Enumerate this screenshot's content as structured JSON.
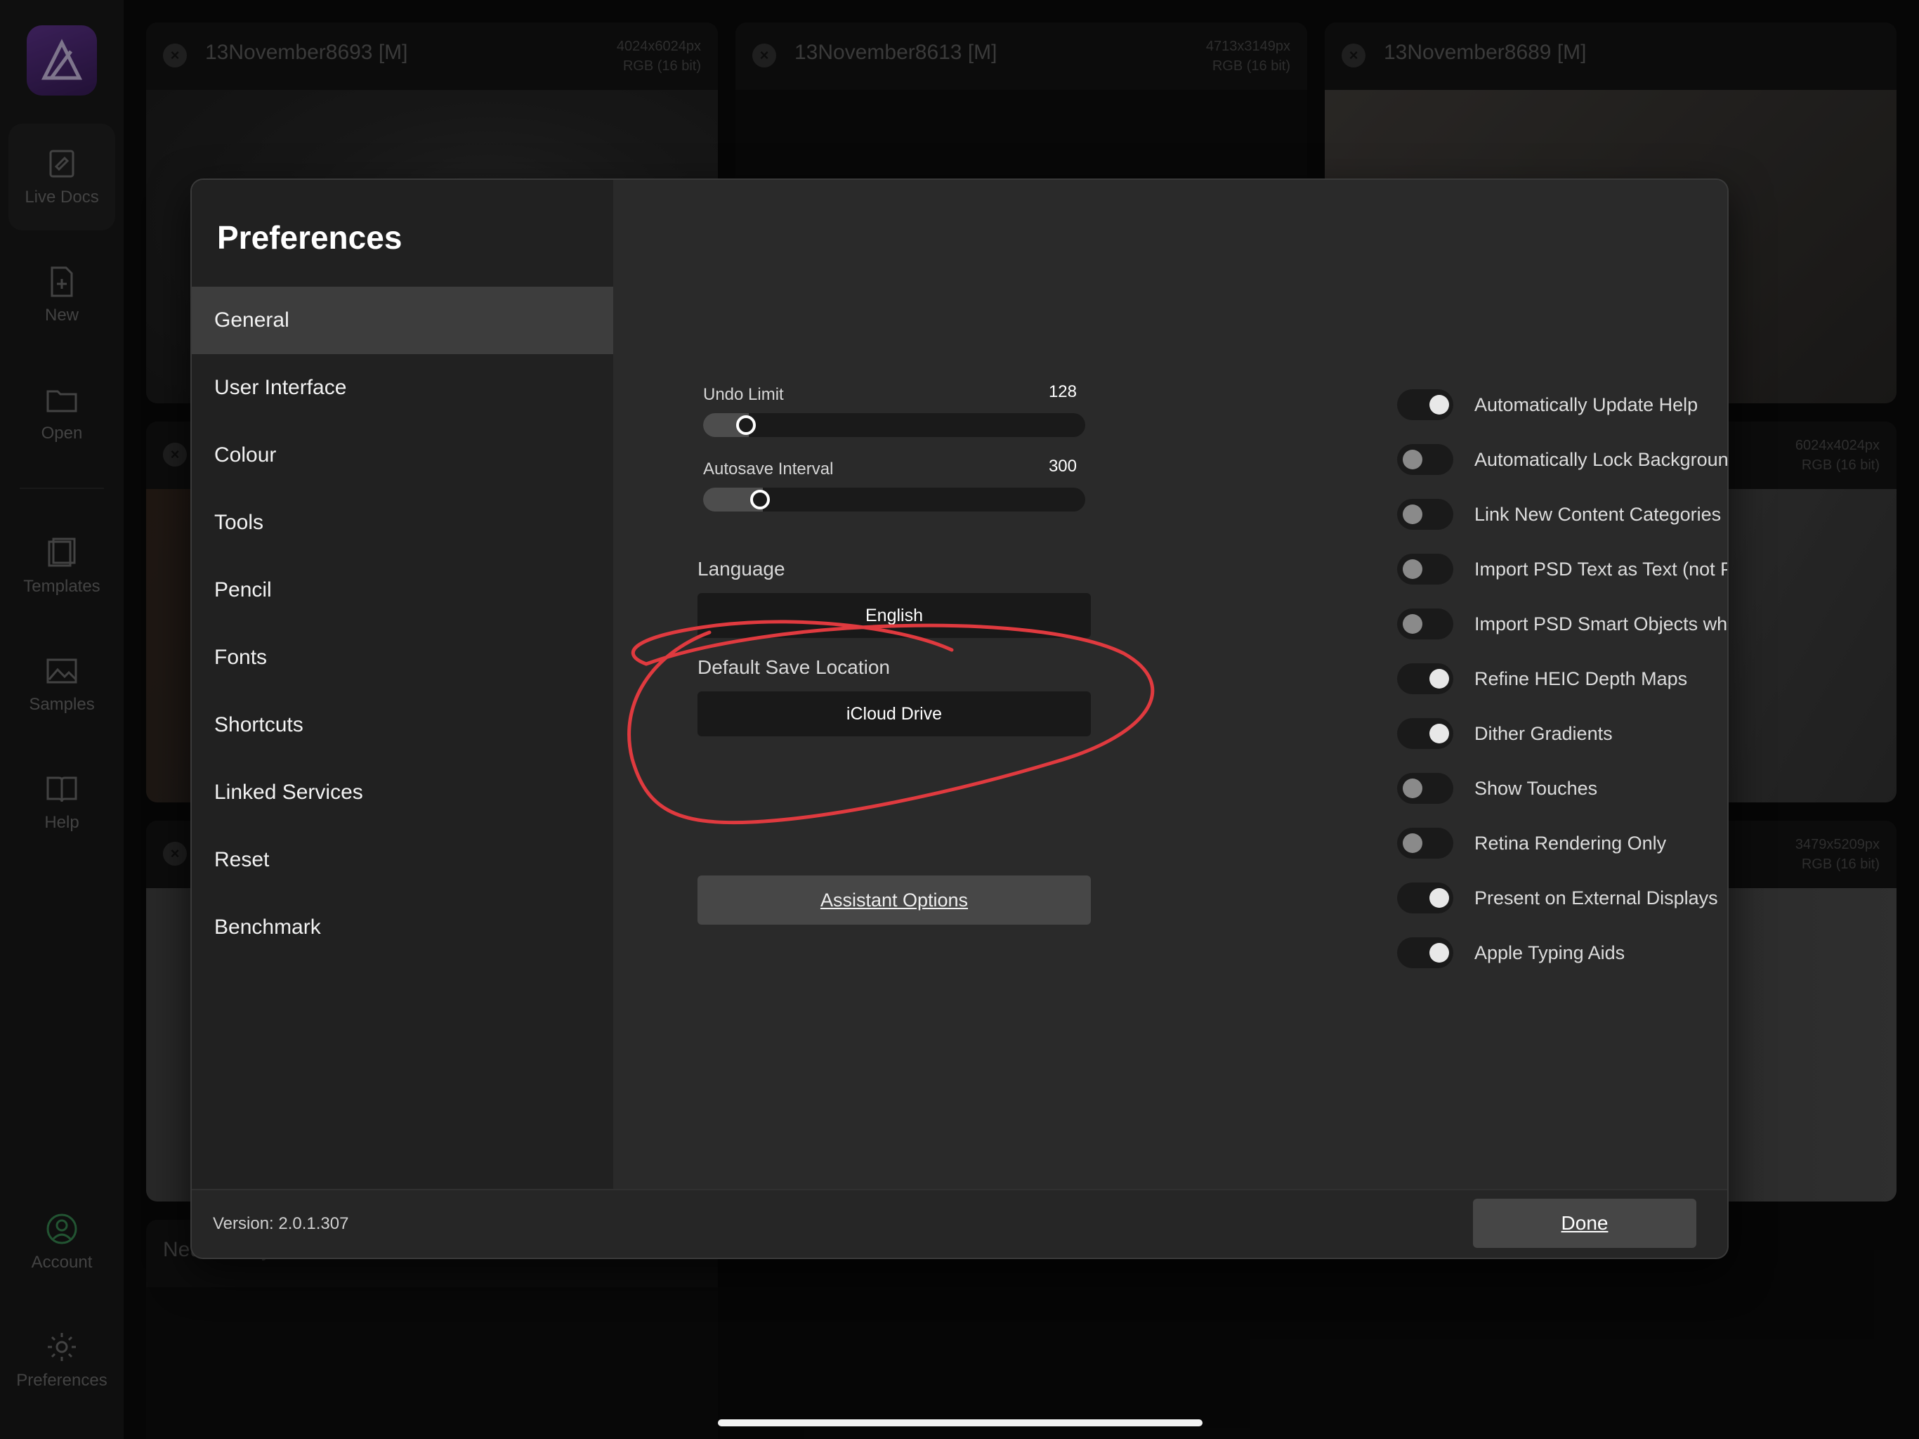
{
  "rail": {
    "items": [
      {
        "label": "Live Docs",
        "icon": "live-docs-icon"
      },
      {
        "label": "New",
        "icon": "new-document-icon"
      },
      {
        "label": "Open",
        "icon": "folder-icon"
      },
      {
        "label": "Templates",
        "icon": "templates-icon"
      },
      {
        "label": "Samples",
        "icon": "image-icon"
      },
      {
        "label": "Help",
        "icon": "book-icon"
      }
    ],
    "account_label": "Account",
    "preferences_label": "Preferences"
  },
  "documents": [
    {
      "title": "13November8693 [M]",
      "size": "4024x6024px",
      "mode": "RGB (16 bit)"
    },
    {
      "title": "13November8613 [M]",
      "size": "4713x3149px",
      "mode": "RGB (16 bit)"
    },
    {
      "title": "13November8689 [M]",
      "size": "",
      "mode": ""
    },
    {
      "title": "",
      "size": "6024x4024px",
      "mode": "RGB (16 bit)"
    },
    {
      "title": "",
      "size": "3479x5209px",
      "mode": "RGB (16 bit)"
    },
    {
      "title": "Neues Projekt",
      "size": "",
      "mode": ""
    }
  ],
  "dialog": {
    "title": "Preferences",
    "nav": [
      "General",
      "User Interface",
      "Colour",
      "Tools",
      "Pencil",
      "Fonts",
      "Shortcuts",
      "Linked Services",
      "Reset",
      "Benchmark"
    ],
    "selected_nav": "General",
    "undo_limit": {
      "label": "Undo Limit",
      "value": "128",
      "fraction": 0.08
    },
    "autosave_interval": {
      "label": "Autosave Interval",
      "value": "300",
      "fraction": 0.12
    },
    "language": {
      "label": "Language",
      "value": "English"
    },
    "default_save_location": {
      "label": "Default Save Location",
      "value": "iCloud Drive"
    },
    "assistant_options_label": "Assistant Options",
    "toggles": [
      {
        "label": "Automatically Update Help",
        "on": true
      },
      {
        "label": "Automatically Lock Background Layer on Import",
        "on": false
      },
      {
        "label": "Link New Content Categories",
        "on": false
      },
      {
        "label": "Import PSD Text as Text (not Pixel Layers)",
        "on": false
      },
      {
        "label": "Import PSD Smart Objects where Possible",
        "on": false
      },
      {
        "label": "Refine HEIC Depth Maps",
        "on": true
      },
      {
        "label": "Dither Gradients",
        "on": true
      },
      {
        "label": "Show Touches",
        "on": false
      },
      {
        "label": "Retina Rendering Only",
        "on": false
      },
      {
        "label": "Present on External Displays",
        "on": true
      },
      {
        "label": "Apple Typing Aids",
        "on": true
      }
    ],
    "version": "Version: 2.0.1.307",
    "done_label": "Done"
  },
  "annotation_color": "#e03a3f"
}
